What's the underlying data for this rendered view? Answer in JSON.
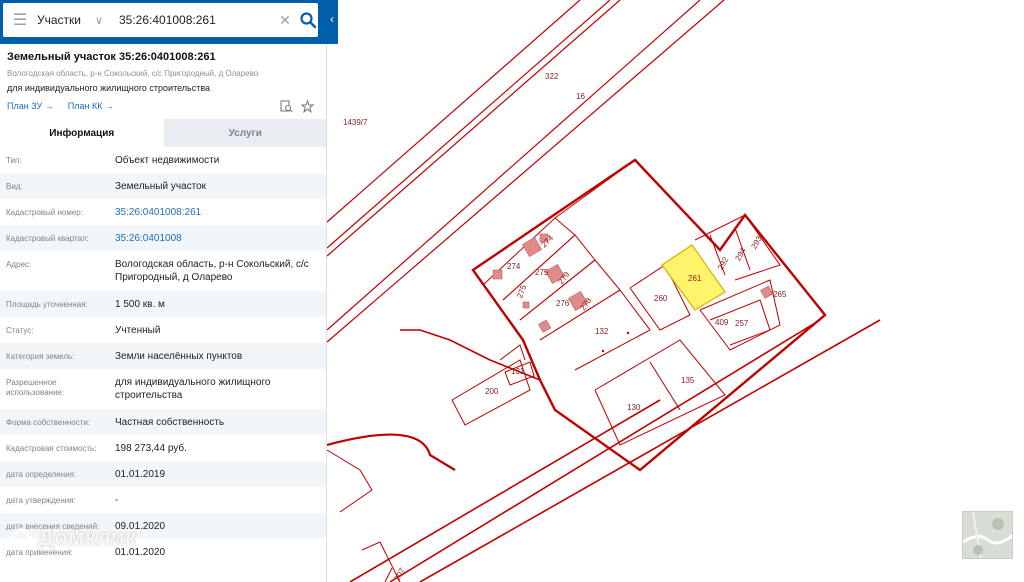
{
  "search": {
    "type_label": "Участки",
    "query": "35:26:401008:261"
  },
  "object": {
    "title": "Земельный участок 35:26:0401008:261",
    "address_short": "Вологодская область, р-н Сокольский, с/с Пригородный, д Оларево",
    "purpose": "для индивидуального жилищного строительства",
    "plan_zu": "План ЗУ →",
    "plan_kk": "План КК →"
  },
  "tabs": [
    {
      "label": "Информация"
    },
    {
      "label": "Услуги"
    }
  ],
  "rows": [
    {
      "label": "Тип:",
      "value": "Объект недвижимости"
    },
    {
      "label": "Вид:",
      "value": "Земельный участок"
    },
    {
      "label": "Кадастровый номер:",
      "value": "35:26:0401008:261"
    },
    {
      "label": "Кадастровый квартал:",
      "value": "35:26:0401008"
    },
    {
      "label": "Адрес:",
      "value": "Вологодская область, р-н Сокольский, с/с Пригородный, д Оларево"
    },
    {
      "label": "Площадь уточненная:",
      "value": "1 500 кв. м"
    },
    {
      "label": "Статус:",
      "value": "Учтенный"
    },
    {
      "label": "Категория земель:",
      "value": "Земли населённых пунктов"
    },
    {
      "label": "Разрешенное использование:",
      "value": "для индивидуального жилищного строительства"
    },
    {
      "label": "Форма собственности:",
      "value": "Частная собственность"
    },
    {
      "label": "Кадастровая стоимость:",
      "value": "198 273,44 руб."
    },
    {
      "label": "дата определения:",
      "value": "01.01.2019"
    },
    {
      "label": "дата утверждения:",
      "value": "-"
    },
    {
      "label": "дата внесения сведений:",
      "value": "09.01.2020"
    },
    {
      "label": "дата применения:",
      "value": "01.01.2020"
    }
  ],
  "watermark": "Домклик",
  "map": {
    "labels": {
      "p322": "322",
      "p16": "16",
      "p1439": "1439/7",
      "p274a": "274",
      "p274b": "274",
      "p275a": "275",
      "p275b": "275",
      "p279": "279",
      "p276": "276",
      "p278": "278",
      "p132": "132",
      "p261": "261",
      "p260": "260",
      "p292": "292",
      "p294": "294",
      "p293": "293",
      "p265": "265",
      "p409": "409",
      "p257": "257",
      "p131": "131",
      "p200": "200",
      "p135": "135",
      "p130": "130",
      "p207": "207"
    },
    "colors": {
      "boundary": "#c00000",
      "building": "#e08a8a",
      "selected_fill": "#fff46a",
      "selected_stroke": "#d4b000"
    }
  }
}
